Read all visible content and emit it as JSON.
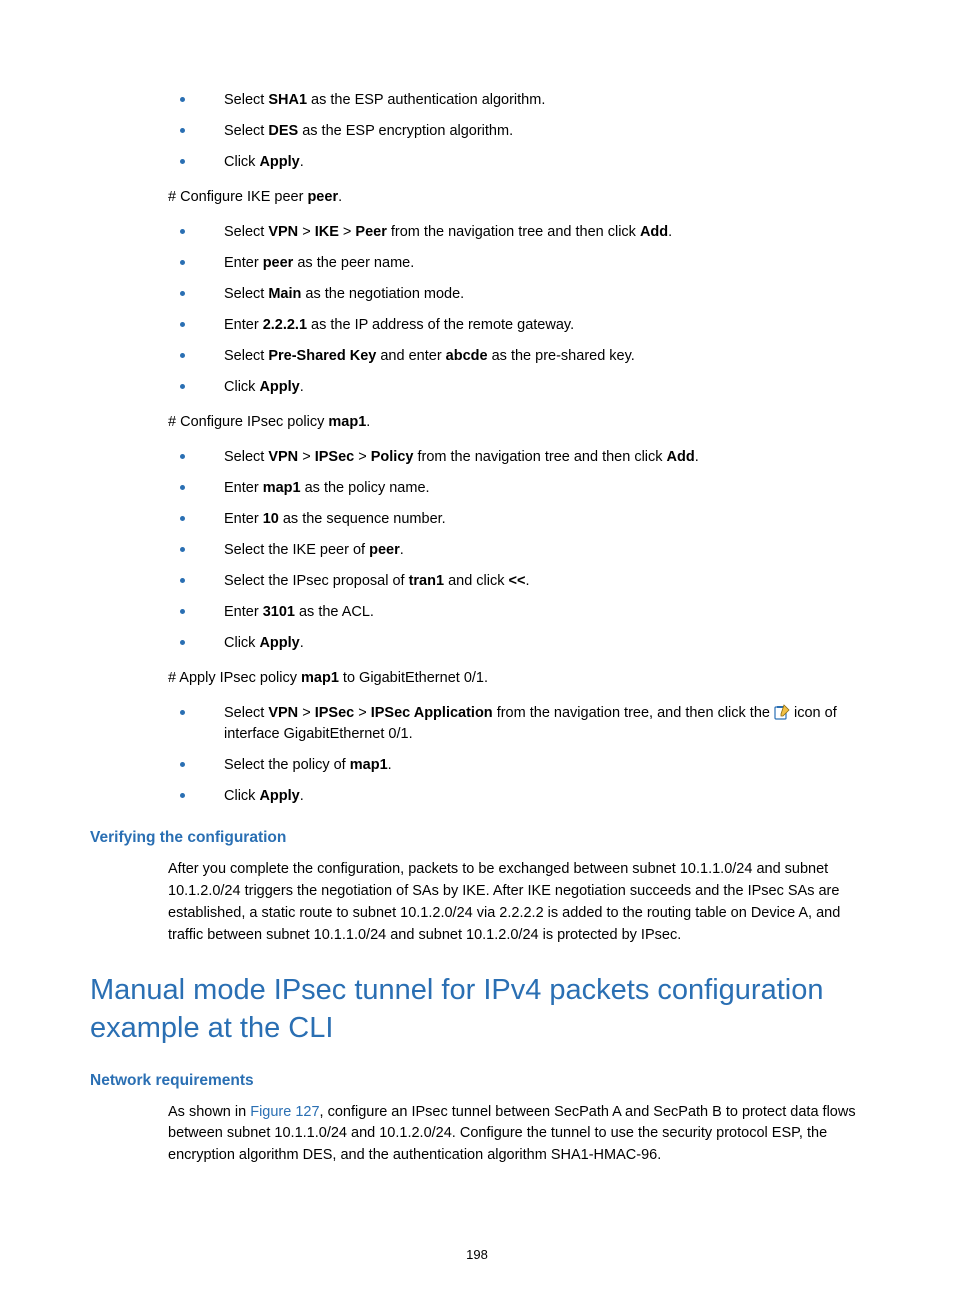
{
  "list1": [
    {
      "pre": "Select ",
      "bold": "SHA1",
      "post": " as the ESP authentication algorithm."
    },
    {
      "pre": "Select ",
      "bold": "DES",
      "post": " as the ESP encryption algorithm."
    },
    {
      "pre": "Click ",
      "bold": "Apply",
      "post": "."
    }
  ],
  "step1": {
    "pre": "# Configure IKE peer ",
    "bold": "peer",
    "post": "."
  },
  "list2": [
    {
      "pre": "Select ",
      "bold": "VPN",
      "mid1": " > ",
      "bold2": "IKE",
      "mid2": " > ",
      "bold3": "Peer",
      "mid3": " from the navigation tree and then click ",
      "bold4": "Add",
      "post": "."
    },
    {
      "pre": "Enter ",
      "bold": "peer",
      "post": " as the peer name."
    },
    {
      "pre": "Select ",
      "bold": "Main",
      "post": " as the negotiation mode."
    },
    {
      "pre": "Enter ",
      "bold": "2.2.2.1",
      "post": " as the IP address of the remote gateway."
    },
    {
      "pre": "Select ",
      "bold": "Pre-Shared Key",
      "mid1": " and enter ",
      "bold2": "abcde",
      "post": " as the pre-shared key."
    },
    {
      "pre": "Click ",
      "bold": "Apply",
      "post": "."
    }
  ],
  "step2": {
    "pre": "# Configure IPsec policy ",
    "bold": "map1",
    "post": "."
  },
  "list3": [
    {
      "pre": "Select ",
      "bold": "VPN",
      "mid1": " > ",
      "bold2": "IPSec",
      "mid2": " > ",
      "bold3": "Policy",
      "mid3": " from the navigation tree and then click ",
      "bold4": "Add",
      "post": "."
    },
    {
      "pre": "Enter ",
      "bold": "map1",
      "post": " as the policy name."
    },
    {
      "pre": "Enter ",
      "bold": "10",
      "post": " as the sequence number."
    },
    {
      "pre": "Select the IKE peer of ",
      "bold": "peer",
      "post": "."
    },
    {
      "pre": "Select the IPsec proposal of ",
      "bold": "tran1",
      "mid1": " and click ",
      "bold2": "<<",
      "post": "."
    },
    {
      "pre": "Enter ",
      "bold": "3101",
      "post": " as the ACL."
    },
    {
      "pre": "Click ",
      "bold": "Apply",
      "post": "."
    }
  ],
  "step3": {
    "pre": "# Apply IPsec policy ",
    "bold": "map1",
    "post": " to GigabitEthernet 0/1."
  },
  "list4": [
    {
      "pre": "Select ",
      "bold": "VPN",
      "mid1": " > ",
      "bold2": "IPSec",
      "mid2": " > ",
      "bold3": "IPSec Application",
      "mid3": " from the navigation tree, and then click the ",
      "icon": true,
      "post": " icon of interface GigabitEthernet 0/1."
    },
    {
      "pre": "Select the policy of ",
      "bold": "map1",
      "post": "."
    },
    {
      "pre": "Click ",
      "bold": "Apply",
      "post": "."
    }
  ],
  "heading_verify": "Verifying the configuration",
  "para_verify": "After you complete the configuration, packets to be exchanged between subnet 10.1.1.0/24 and subnet 10.1.2.0/24 triggers the negotiation of SAs by IKE. After IKE negotiation succeeds and the IPsec SAs are established, a static route to subnet 10.1.2.0/24 via 2.2.2.2 is added to the routing table on Device A, and traffic between subnet 10.1.1.0/24 and subnet 10.1.2.0/24 is protected by IPsec.",
  "heading_main": "Manual mode IPsec tunnel for IPv4 packets configuration example at the CLI",
  "heading_netreq": "Network requirements",
  "para_netreq": {
    "pre": "As shown in ",
    "link": "Figure 127",
    "post": ", configure an IPsec tunnel between SecPath A and SecPath B to protect data flows between subnet 10.1.1.0/24 and 10.1.2.0/24. Configure the tunnel to use the security protocol ESP, the encryption algorithm DES, and the authentication algorithm SHA1-HMAC-96."
  },
  "page_number": "198"
}
